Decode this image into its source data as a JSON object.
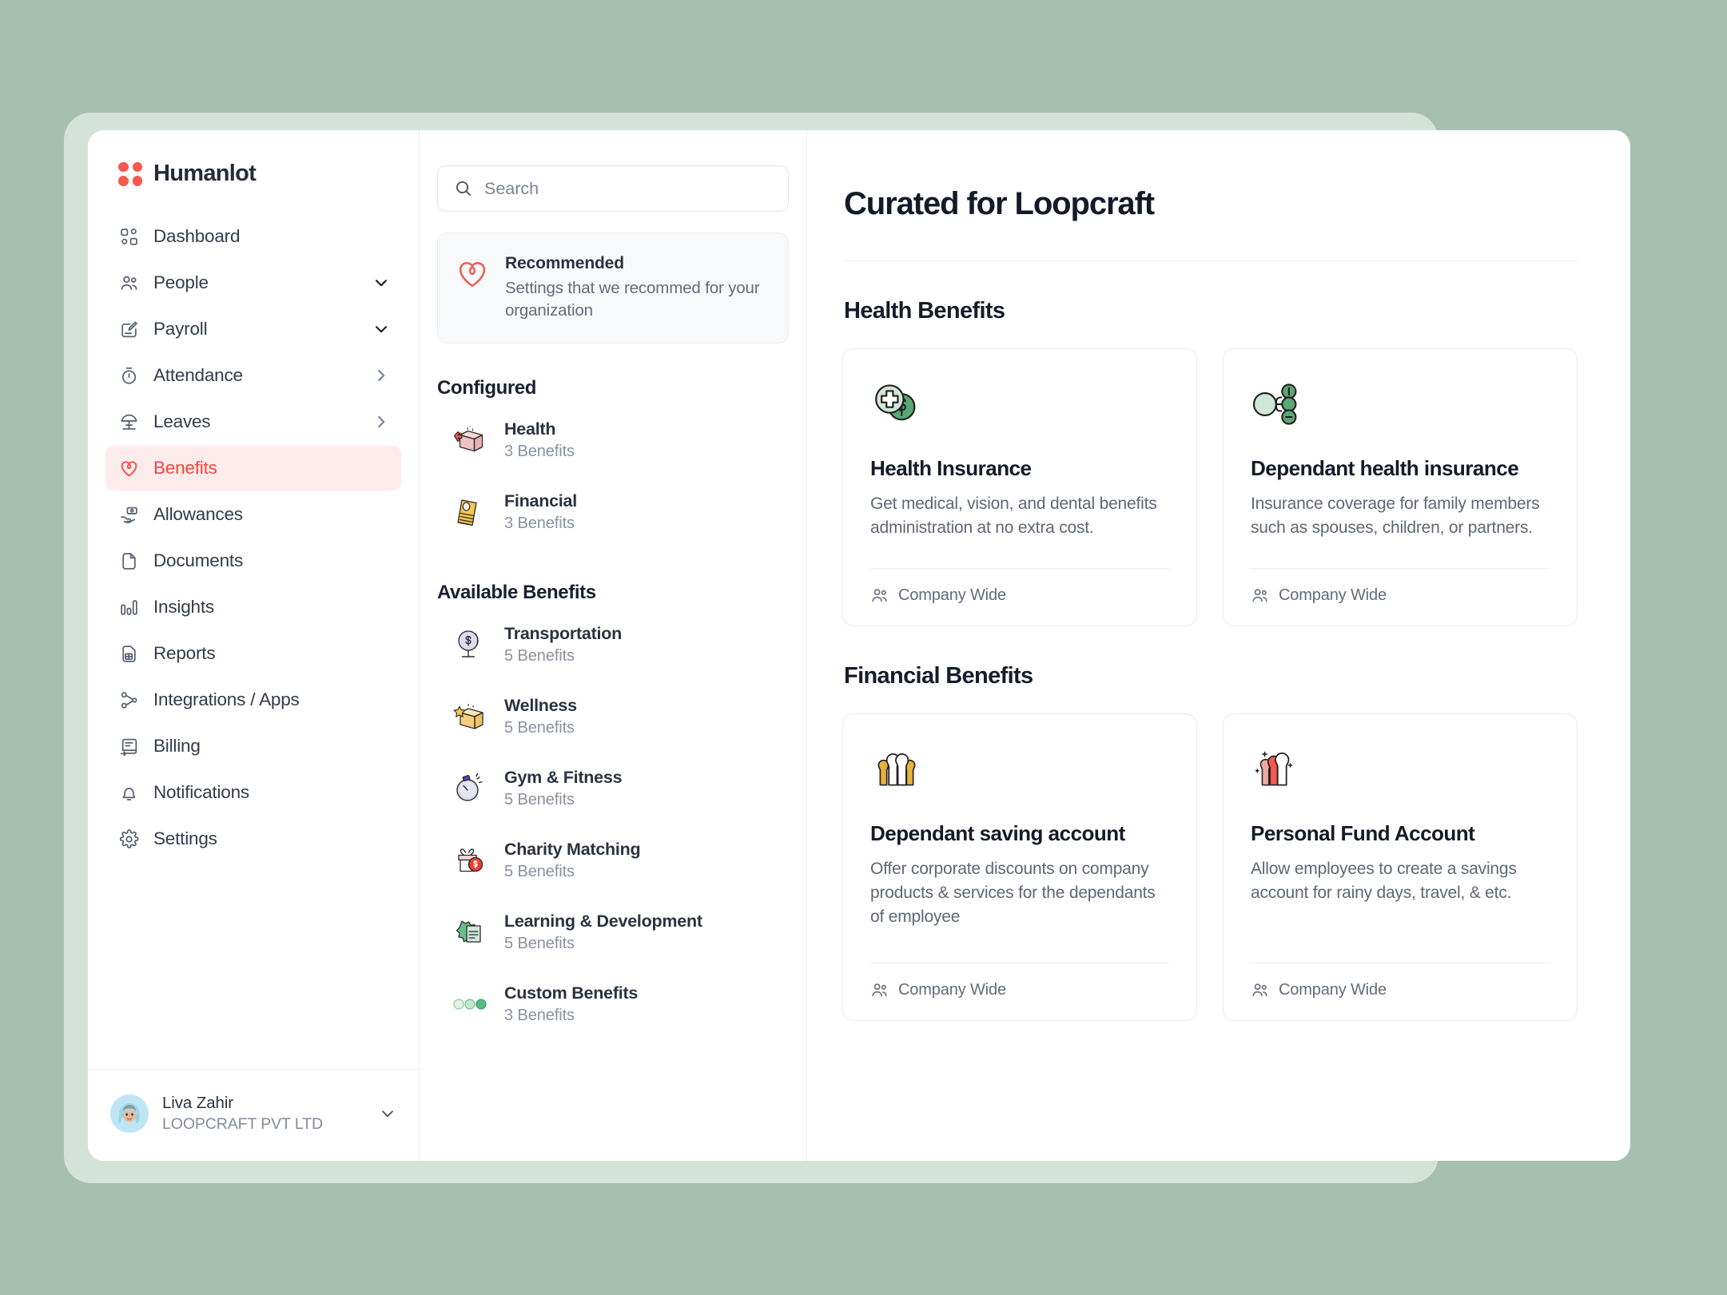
{
  "brand": {
    "name": "Humanlot",
    "logo_icon": "four-dot-clover-icon",
    "accent_color": "#f4594e"
  },
  "sidebar": {
    "items": [
      {
        "label": "Dashboard",
        "icon": "dashboard-grid-icon",
        "trailing": "none",
        "active": false
      },
      {
        "label": "People",
        "icon": "people-icon",
        "trailing": "chevron-down",
        "active": false
      },
      {
        "label": "Payroll",
        "icon": "payroll-edit-icon",
        "trailing": "chevron-down",
        "active": false
      },
      {
        "label": "Attendance",
        "icon": "stopwatch-icon",
        "trailing": "chevron-right",
        "active": false
      },
      {
        "label": "Leaves",
        "icon": "beach-umbrella-icon",
        "trailing": "chevron-right",
        "active": false
      },
      {
        "label": "Benefits",
        "icon": "heart-icon",
        "trailing": "none",
        "active": true
      },
      {
        "label": "Allowances",
        "icon": "hand-cash-icon",
        "trailing": "none",
        "active": false
      },
      {
        "label": "Documents",
        "icon": "document-icon",
        "trailing": "none",
        "active": false
      },
      {
        "label": "Insights",
        "icon": "bar-chart-icon",
        "trailing": "none",
        "active": false
      },
      {
        "label": "Reports",
        "icon": "report-file-icon",
        "trailing": "none",
        "active": false
      },
      {
        "label": "Integrations / Apps",
        "icon": "network-nodes-icon",
        "trailing": "none",
        "active": false
      },
      {
        "label": "Billing",
        "icon": "invoice-icon",
        "trailing": "none",
        "active": false
      },
      {
        "label": "Notifications",
        "icon": "bell-icon",
        "trailing": "none",
        "active": false
      },
      {
        "label": "Settings",
        "icon": "gear-icon",
        "trailing": "none",
        "active": false
      }
    ],
    "user": {
      "name": "Liva Zahir",
      "org": "LOOPCRAFT PVT LTD",
      "avatar_icon": "avatar-woman-hijab",
      "chevron_icon": "chevron-down-icon"
    }
  },
  "mid": {
    "search": {
      "placeholder": "Search",
      "value": "",
      "icon": "search-icon"
    },
    "recommended": {
      "icon": "heart-icon",
      "title": "Recommended",
      "desc": "Settings that we recommed for your organization"
    },
    "configured_heading": "Configured",
    "configured": [
      {
        "name": "Health",
        "count": "3 Benefits",
        "icon": "health-box-icon"
      },
      {
        "name": "Financial",
        "count": "3 Benefits",
        "icon": "financial-doc-icon"
      }
    ],
    "available_heading": "Available Benefits",
    "available": [
      {
        "name": "Transportation",
        "count": "5 Benefits",
        "icon": "globe-dollar-icon"
      },
      {
        "name": "Wellness",
        "count": "5 Benefits",
        "icon": "star-box-icon"
      },
      {
        "name": "Gym & Fitness",
        "count": "5 Benefits",
        "icon": "stopwatch-icon"
      },
      {
        "name": "Charity Matching",
        "count": "5 Benefits",
        "icon": "gift-coin-icon"
      },
      {
        "name": "Learning & Development",
        "count": "5 Benefits",
        "icon": "badge-book-icon"
      },
      {
        "name": "Custom Benefits",
        "count": "3 Benefits",
        "icon": "three-dots-icon"
      }
    ]
  },
  "main": {
    "title": "Curated for Loopcraft",
    "groups": [
      {
        "heading": "Health Benefits",
        "cards": [
          {
            "title": "Health Insurance",
            "desc": "Get medical, vision, and dental benefits administration at no extra cost.",
            "scope": "Company Wide",
            "scope_icon": "people-icon",
            "icon": "medical-coins-icon"
          },
          {
            "title": "Dependant health insurance",
            "desc": "Insurance coverage for family members such as spouses, children, or partners.",
            "scope": "Company Wide",
            "scope_icon": "people-icon",
            "icon": "dependant-tree-icon"
          }
        ]
      },
      {
        "heading": "Financial Benefits",
        "cards": [
          {
            "title": "Dependant saving account",
            "desc": "Offer corporate discounts on company products & services for the dependants of employee",
            "scope": "Company Wide",
            "scope_icon": "people-icon",
            "icon": "three-people-yellow-icon"
          },
          {
            "title": "Personal Fund Account",
            "desc": "Allow employees to create a savings account for rainy days, travel, & etc.",
            "scope": "Company Wide",
            "scope_icon": "people-icon",
            "icon": "two-people-red-icon"
          }
        ]
      }
    ]
  }
}
